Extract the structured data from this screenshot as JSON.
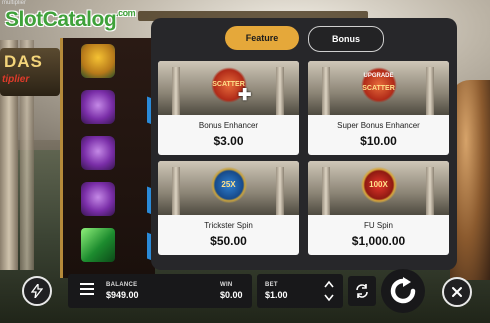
{
  "watermark": {
    "text": "SlotCatalog",
    "suffix": ".com"
  },
  "game": {
    "top_left_label": "multiplier",
    "logo_word": "DAS",
    "logo_sub": "tiplier"
  },
  "popup": {
    "tabs": [
      {
        "label": "Feature",
        "active": true
      },
      {
        "label": "Bonus",
        "active": false
      }
    ],
    "cards": [
      {
        "name": "Bonus Enhancer",
        "price": "$3.00",
        "emblem_text": "SCATTER",
        "icon": "scatter-plus-icon"
      },
      {
        "name": "Super Bonus Enhancer",
        "price": "$10.00",
        "emblem_top": "UPGRADE",
        "emblem_text": "SCATTER",
        "icon": "upgrade-scatter-icon"
      },
      {
        "name": "Trickster Spin",
        "price": "$50.00",
        "emblem_text": "25X",
        "icon": "trickster-25x-icon"
      },
      {
        "name": "FU Spin",
        "price": "$1,000.00",
        "emblem_text": "100X",
        "icon": "fu-100x-icon"
      }
    ]
  },
  "bottom_bar": {
    "balance_label": "BALANCE",
    "balance_value": "$949.00",
    "win_label": "WIN",
    "win_value": "$0.00",
    "bet_label": "BET",
    "bet_value": "$1.00"
  },
  "colors": {
    "accent": "#e5a83a",
    "popup_bg": "#27272a",
    "card_bg": "#f7f7f7",
    "watermark": "#3fa13a"
  }
}
